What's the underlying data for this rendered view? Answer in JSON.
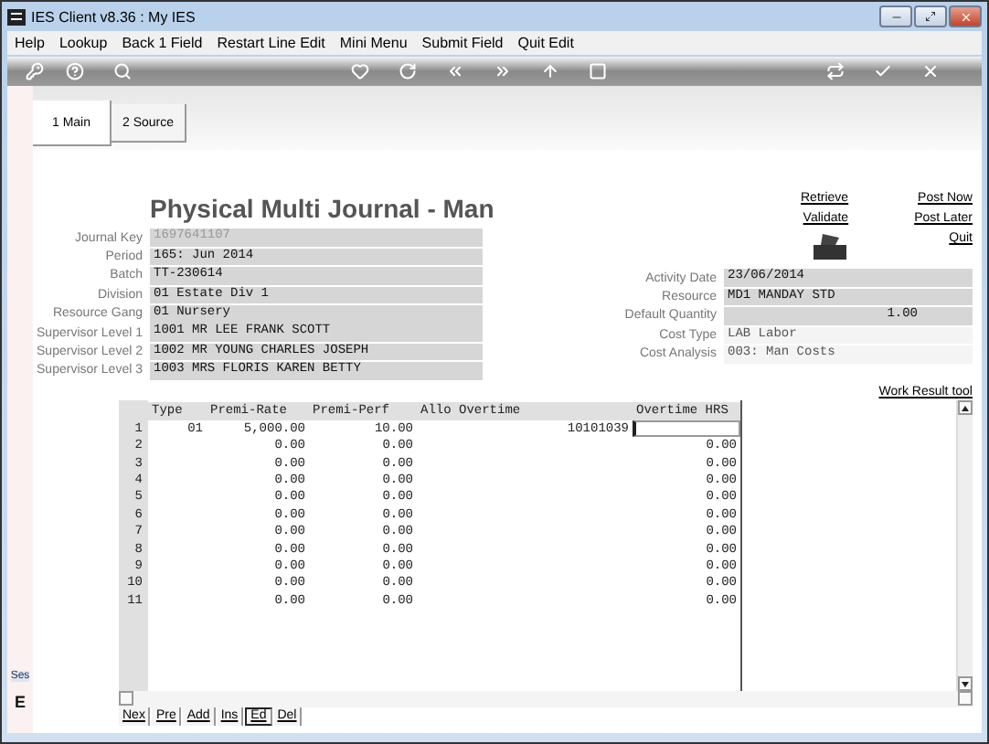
{
  "window": {
    "title": "IES Client v8.36 : My IES"
  },
  "menu": [
    "Help",
    "Lookup",
    "Back 1 Field",
    "Restart Line Edit",
    "Mini Menu",
    "Submit Field",
    "Quit Edit"
  ],
  "tabs": [
    {
      "label": "1 Main",
      "selected": true
    },
    {
      "label": "2 Source",
      "selected": false
    }
  ],
  "form": {
    "title": "Physical Multi Journal - Man",
    "links_left": [
      "Retrieve",
      "Validate"
    ],
    "links_right": [
      "Post Now",
      "Post Later",
      "Quit"
    ],
    "fields_left": [
      {
        "label": "Journal Key",
        "value": "1697641107",
        "kind": "input",
        "disabled": true
      },
      {
        "label": "Period",
        "value": "165: Jun 2014",
        "kind": "input",
        "disabled": false
      },
      {
        "label": "Batch",
        "value": "TT-230614",
        "kind": "input",
        "disabled": false
      },
      {
        "label": "Division",
        "value": "01 Estate Div 1",
        "kind": "input",
        "disabled": false
      },
      {
        "label": "Resource Gang",
        "value": "01 Nursery",
        "kind": "input",
        "disabled": false
      },
      {
        "label": "Supervisor Level 1",
        "value": "1001 MR LEE FRANK SCOTT",
        "kind": "input",
        "disabled": false
      },
      {
        "label": "Supervisor Level 2",
        "value": "1002 MR YOUNG CHARLES JOSEPH",
        "kind": "input",
        "disabled": false
      },
      {
        "label": "Supervisor Level 3",
        "value": "1003 MRS FLORIS KAREN BETTY",
        "kind": "input",
        "disabled": false
      }
    ],
    "fields_right": [
      {
        "label": "Activity Date",
        "value": "23/06/2014",
        "kind": "input",
        "disabled": false
      },
      {
        "label": "Resource",
        "value": "MD1 MANDAY STD",
        "kind": "input",
        "disabled": false
      },
      {
        "label": "Default Quantity",
        "value": "1.00",
        "kind": "numeric",
        "disabled": false
      },
      {
        "label": "Cost Type",
        "value": "LAB Labor",
        "kind": "display",
        "disabled": false
      },
      {
        "label": "Cost Analysis",
        "value": "003: Man Costs",
        "kind": "display",
        "disabled": false
      }
    ],
    "tool_link": "Work Result tool"
  },
  "table": {
    "columns": [
      "Type",
      "Premi-Rate",
      "Premi-Perf",
      "Allo Overtime",
      "Overtime HRS"
    ],
    "rows": [
      {
        "num": "1",
        "cells": [
          "01",
          "5,000.00",
          "10.00",
          "10101039",
          ""
        ],
        "active": true
      },
      {
        "num": "2",
        "cells": [
          "",
          "0.00",
          "0.00",
          "",
          "0.00"
        ],
        "active": false
      },
      {
        "num": "3",
        "cells": [
          "",
          "0.00",
          "0.00",
          "",
          "0.00"
        ],
        "active": false
      },
      {
        "num": "4",
        "cells": [
          "",
          "0.00",
          "0.00",
          "",
          "0.00"
        ],
        "active": false
      },
      {
        "num": "5",
        "cells": [
          "",
          "0.00",
          "0.00",
          "",
          "0.00"
        ],
        "active": false
      },
      {
        "num": "6",
        "cells": [
          "",
          "0.00",
          "0.00",
          "",
          "0.00"
        ],
        "active": false
      },
      {
        "num": "7",
        "cells": [
          "",
          "0.00",
          "0.00",
          "",
          "0.00"
        ],
        "active": false
      },
      {
        "num": "8",
        "cells": [
          "",
          "0.00",
          "0.00",
          "",
          "0.00"
        ],
        "active": false
      },
      {
        "num": "9",
        "cells": [
          "",
          "0.00",
          "0.00",
          "",
          "0.00"
        ],
        "active": false
      },
      {
        "num": "10",
        "cells": [
          "",
          "0.00",
          "0.00",
          "",
          "0.00"
        ],
        "active": false
      },
      {
        "num": "11",
        "cells": [
          "",
          "0.00",
          "0.00",
          "",
          "0.00"
        ],
        "active": false
      }
    ]
  },
  "row_buttons": [
    {
      "label": "Nex",
      "selected": false
    },
    {
      "label": "Pre",
      "selected": false
    },
    {
      "label": "Add",
      "selected": false
    },
    {
      "label": "Ins",
      "selected": false
    },
    {
      "label": "Ed",
      "selected": true
    },
    {
      "label": "Del",
      "selected": false
    }
  ],
  "side": {
    "tab": "Ses",
    "letter": "E"
  }
}
